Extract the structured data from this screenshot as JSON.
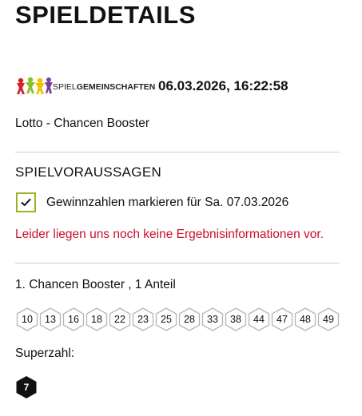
{
  "page": {
    "title": "SPIELDETAILS"
  },
  "header": {
    "logo_text_light": "SPIEL",
    "logo_text_bold": "GEMEINSCHAFTEN",
    "datetime": "06.03.2026, 16:22:58"
  },
  "game": {
    "name": "Lotto - Chancen Booster"
  },
  "predictions": {
    "title": "SPIELVORAUSSAGEN",
    "mark_checkbox_checked": true,
    "mark_label": "Gewinnzahlen markieren für Sa. 07.03.2026",
    "error_message": "Leider liegen uns noch keine Ergebnisinformationen vor."
  },
  "tipp": {
    "label": "1. Chancen Booster , 1 Anteil",
    "numbers": [
      "10",
      "13",
      "16",
      "18",
      "22",
      "23",
      "25",
      "28",
      "33",
      "38",
      "44",
      "47",
      "48",
      "49"
    ],
    "superzahl_label": "Superzahl:",
    "superzahl": "7"
  },
  "colors": {
    "accent_green": "#9cb22a",
    "error_red": "#c8102e",
    "hex_border": "#b5b5b5",
    "superzahl_bg": "#111111"
  }
}
